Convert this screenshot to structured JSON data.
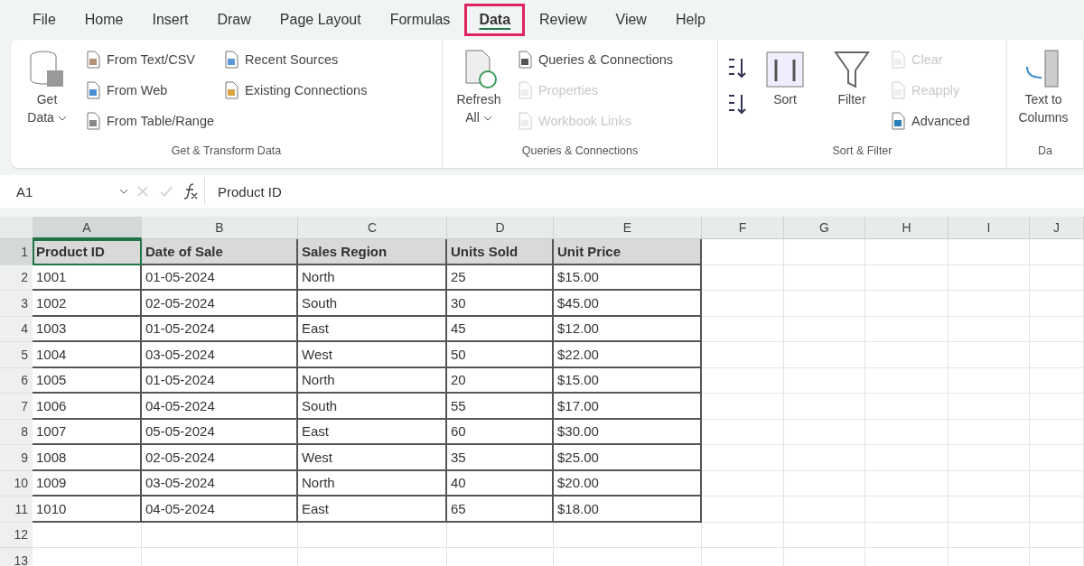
{
  "tabs": [
    {
      "label": "File",
      "selected": false
    },
    {
      "label": "Home",
      "selected": false
    },
    {
      "label": "Insert",
      "selected": false
    },
    {
      "label": "Draw",
      "selected": false
    },
    {
      "label": "Page Layout",
      "selected": false
    },
    {
      "label": "Formulas",
      "selected": false
    },
    {
      "label": "Data",
      "selected": true
    },
    {
      "label": "Review",
      "selected": false
    },
    {
      "label": "View",
      "selected": false
    },
    {
      "label": "Help",
      "selected": false
    }
  ],
  "ribbon": [
    {
      "label": "Get & Transform Data",
      "columns": [
        {
          "kind": "big",
          "lines": [
            "Get",
            "Data"
          ],
          "dropdown": true
        },
        {
          "kind": "small",
          "items": [
            {
              "label": "From Text/CSV",
              "disabled": false
            },
            {
              "label": "From Web",
              "disabled": false
            },
            {
              "label": "From Table/Range",
              "disabled": false
            }
          ]
        },
        {
          "kind": "small",
          "items": [
            {
              "label": "Recent Sources",
              "disabled": false
            },
            {
              "label": "Existing Connections",
              "disabled": false
            }
          ]
        }
      ]
    },
    {
      "label": "Queries & Connections",
      "columns": [
        {
          "kind": "big",
          "lines": [
            "Refresh",
            "All"
          ],
          "dropdown": true
        },
        {
          "kind": "small",
          "items": [
            {
              "label": "Queries & Connections",
              "disabled": false
            },
            {
              "label": "Properties",
              "disabled": true
            },
            {
              "label": "Workbook Links",
              "disabled": true
            }
          ]
        }
      ]
    },
    {
      "label": "Sort & Filter",
      "columns": [
        {
          "kind": "sort"
        },
        {
          "kind": "big",
          "lines": [
            "Sort"
          ],
          "dropdown": false
        },
        {
          "kind": "big",
          "lines": [
            "Filter"
          ],
          "dropdown": false
        },
        {
          "kind": "small",
          "items": [
            {
              "label": "Clear",
              "disabled": true
            },
            {
              "label": "Reapply",
              "disabled": true
            },
            {
              "label": "Advanced",
              "disabled": false
            }
          ]
        }
      ]
    },
    {
      "label": "Da",
      "columns": [
        {
          "kind": "big",
          "lines": [
            "Text to",
            "Columns"
          ],
          "dropdown": false
        }
      ]
    }
  ],
  "formula_bar": {
    "name_box": "A1",
    "formula": "Product ID"
  },
  "sheet": {
    "columns": [
      {
        "label": "A",
        "selected": true
      },
      {
        "label": "B",
        "selected": false
      },
      {
        "label": "C",
        "selected": false
      },
      {
        "label": "D",
        "selected": false
      },
      {
        "label": "E",
        "selected": false
      },
      {
        "label": "F",
        "selected": false
      },
      {
        "label": "G",
        "selected": false
      },
      {
        "label": "H",
        "selected": false
      },
      {
        "label": "I",
        "selected": false
      },
      {
        "label": "J",
        "selected": false
      }
    ],
    "rows": [
      {
        "number": "1",
        "selected": true,
        "kind": "header",
        "cells": [
          "Product ID",
          "Date of Sale",
          "Sales Region",
          "Units Sold",
          "Unit Price"
        ]
      },
      {
        "number": "2",
        "selected": false,
        "kind": "data",
        "cells": [
          "1001",
          "01-05-2024",
          "North",
          "25",
          "$15.00"
        ]
      },
      {
        "number": "3",
        "selected": false,
        "kind": "data",
        "cells": [
          "1002",
          "02-05-2024",
          "South",
          "30",
          "$45.00"
        ]
      },
      {
        "number": "4",
        "selected": false,
        "kind": "data",
        "cells": [
          "1003",
          "01-05-2024",
          "East",
          "45",
          "$12.00"
        ]
      },
      {
        "number": "5",
        "selected": false,
        "kind": "data",
        "cells": [
          "1004",
          "03-05-2024",
          "West",
          "50",
          "$22.00"
        ]
      },
      {
        "number": "6",
        "selected": false,
        "kind": "data",
        "cells": [
          "1005",
          "01-05-2024",
          "North",
          "20",
          "$15.00"
        ]
      },
      {
        "number": "7",
        "selected": false,
        "kind": "data",
        "cells": [
          "1006",
          "04-05-2024",
          "South",
          "55",
          "$17.00"
        ]
      },
      {
        "number": "8",
        "selected": false,
        "kind": "data",
        "cells": [
          "1007",
          "05-05-2024",
          "East",
          "60",
          "$30.00"
        ]
      },
      {
        "number": "9",
        "selected": false,
        "kind": "data",
        "cells": [
          "1008",
          "02-05-2024",
          "West",
          "35",
          "$25.00"
        ]
      },
      {
        "number": "10",
        "selected": false,
        "kind": "data",
        "cells": [
          "1009",
          "03-05-2024",
          "North",
          "40",
          "$20.00"
        ]
      },
      {
        "number": "11",
        "selected": false,
        "kind": "data",
        "cells": [
          "1010",
          "04-05-2024",
          "East",
          "65",
          "$18.00"
        ]
      },
      {
        "number": "12",
        "selected": false,
        "kind": "empty"
      },
      {
        "number": "13",
        "selected": false,
        "kind": "empty"
      }
    ]
  }
}
